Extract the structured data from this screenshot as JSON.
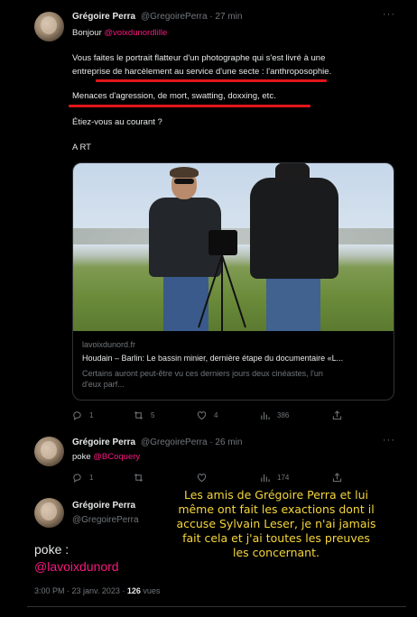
{
  "tweet1": {
    "author_name": "Grégoire Perra",
    "author_handle": "@GregoirePerra",
    "time": "· 27 min",
    "greeting": "Bonjour ",
    "greeting_mention": "@voixdunordlille",
    "line1": "Vous faites le portrait flatteur d'un photographe qui s'est livré à une",
    "line2": "entreprise de harcèlement au service d'une secte : l'anthroposophie.",
    "line3": "Menaces d'agression, de mort, swatting, doxxing, etc.",
    "line4": "Étiez-vous au courant ?",
    "line5": "A RT",
    "card": {
      "domain": "lavoixdunord.fr",
      "title": "Houdain – Barlin: Le bassin minier, dernière étape du documentaire «L...",
      "desc1": "Certains auront peut-être vu ces derniers jours deux cinéastes, l'un",
      "desc2": "d'eux parf..."
    },
    "actions": {
      "replies": "1",
      "retweets": "5",
      "likes": "4",
      "views": "386"
    }
  },
  "tweet2": {
    "author_name": "Grégoire Perra",
    "author_handle": "@GregoirePerra",
    "time": "· 26 min",
    "text": "poke ",
    "mention": "@BCoquery",
    "actions": {
      "replies": "1",
      "retweets": "",
      "likes": "",
      "views": "174"
    }
  },
  "tweet3": {
    "author_name": "Grégoire Perra",
    "author_handle": "@GregoirePerra",
    "text": "poke :",
    "mention": "@lavoixdunord",
    "timestamp": "3:00 PM · 23 janv. 2023 · ",
    "views_count": "126",
    "views_label": " vues"
  },
  "overlay": {
    "line1": "Les amis de Grégoire Perra et lui",
    "line2": "même ont fait les exactions dont il",
    "line3": "accuse Sylvain Leser, je n'ai jamais",
    "line4": "fait cela et j'ai toutes les preuves",
    "line5": "les concernant."
  },
  "more_icon": "···",
  "colors": {
    "mention": "#f91880",
    "underline": "#e0151b",
    "overlay_text": "#f5d63b",
    "muted": "#71767b"
  }
}
